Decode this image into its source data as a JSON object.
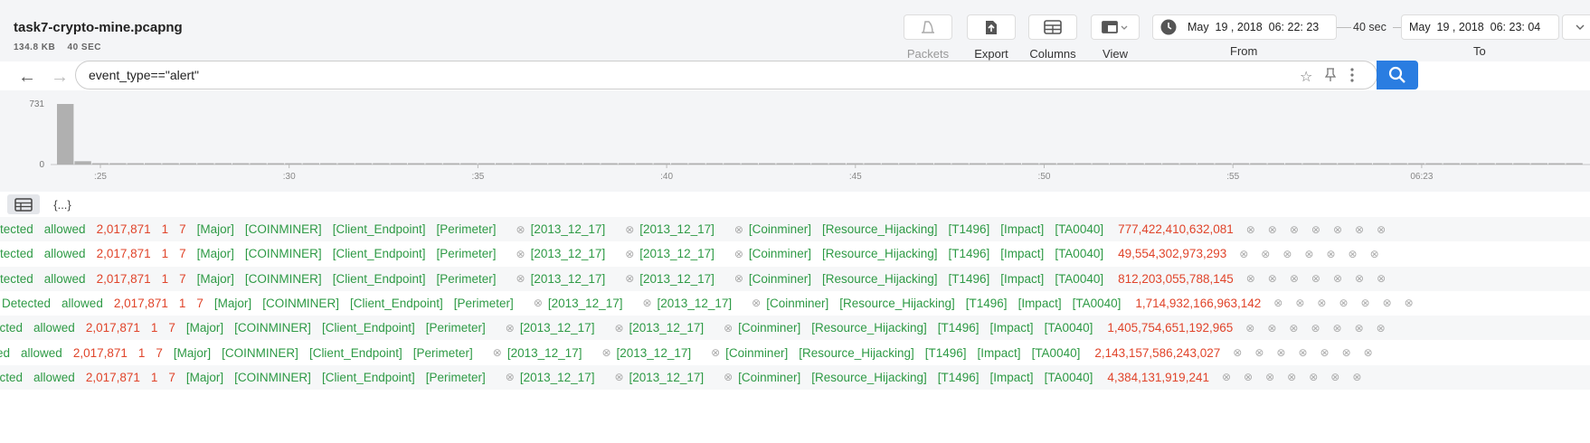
{
  "file": {
    "name": "task7-crypto-mine.pcapng",
    "size": "134.8 KB",
    "duration": "40 SEC"
  },
  "toolbar": {
    "packets": "Packets",
    "export": "Export",
    "columns": "Columns",
    "view": "View",
    "from_value": "May  19 , 2018  06: 22: 23",
    "from_label": "From",
    "span": "40 sec",
    "to_value": "May  19 , 2018  06: 23: 04",
    "to_label": "To"
  },
  "search": {
    "query": "event_type==\"alert\""
  },
  "histogram": {
    "y_max_label": "731",
    "y_min_label": "0",
    "ticks": [
      ":25",
      ":30",
      ":35",
      ":40",
      ":45",
      ":50",
      ":55",
      "06:23"
    ],
    "bar_color": "#b0b0b0",
    "bars": [
      731,
      40,
      3,
      2,
      2,
      1,
      1,
      2,
      1,
      2,
      2,
      1,
      2,
      3,
      1,
      1,
      2,
      1,
      2,
      1,
      2,
      1,
      1,
      2,
      1,
      2,
      1,
      3,
      1,
      1,
      2,
      3,
      8,
      1,
      3,
      2,
      2,
      1,
      2,
      1,
      2,
      2,
      2,
      4,
      1,
      1,
      2,
      1,
      1,
      2,
      4,
      1,
      2,
      1,
      1,
      2,
      1,
      2,
      1,
      2,
      1,
      2,
      1,
      2,
      1,
      2,
      1,
      5,
      2,
      1,
      2,
      1,
      2,
      1,
      2,
      1,
      1,
      8,
      1,
      1,
      2,
      1,
      2,
      1,
      2,
      1,
      12
    ]
  },
  "tabs": {
    "table_icon": "table-icon",
    "json_label": "{...}"
  },
  "colors": {
    "green": "#2e9a45",
    "red": "#e0442a",
    "accent": "#2a7de1"
  },
  "rows": [
    {
      "status": "tected",
      "action": "allowed",
      "sig": "2,017,871",
      "rev": "1",
      "gid": "7",
      "severity": "[Major]",
      "family": "[COINMINER]",
      "target": "[Client_Endpoint]",
      "scope": "[Perimeter]",
      "created": "[2013_12_17]",
      "updated": "[2013_12_17]",
      "tag": "[Coinminer]",
      "category": "[Resource_Hijacking]",
      "technique": "[T1496]",
      "tactic": "[Impact]",
      "tactic_id": "[TA0040]",
      "flow": "777,422,410,632,081"
    },
    {
      "status": "tected",
      "action": "allowed",
      "sig": "2,017,871",
      "rev": "1",
      "gid": "7",
      "severity": "[Major]",
      "family": "[COINMINER]",
      "target": "[Client_Endpoint]",
      "scope": "[Perimeter]",
      "created": "[2013_12_17]",
      "updated": "[2013_12_17]",
      "tag": "[Coinminer]",
      "category": "[Resource_Hijacking]",
      "technique": "[T1496]",
      "tactic": "[Impact]",
      "tactic_id": "[TA0040]",
      "flow": "49,554,302,973,293"
    },
    {
      "status": "tected",
      "action": "allowed",
      "sig": "2,017,871",
      "rev": "1",
      "gid": "7",
      "severity": "[Major]",
      "family": "[COINMINER]",
      "target": "[Client_Endpoint]",
      "scope": "[Perimeter]",
      "created": "[2013_12_17]",
      "updated": "[2013_12_17]",
      "tag": "[Coinminer]",
      "category": "[Resource_Hijacking]",
      "technique": "[T1496]",
      "tactic": "[Impact]",
      "tactic_id": "[TA0040]",
      "flow": "812,203,055,788,145"
    },
    {
      "status": "Detected",
      "action": "allowed",
      "sig": "2,017,871",
      "rev": "1",
      "gid": "7",
      "severity": "[Major]",
      "family": "[COINMINER]",
      "target": "[Client_Endpoint]",
      "scope": "[Perimeter]",
      "created": "[2013_12_17]",
      "updated": "[2013_12_17]",
      "tag": "[Coinminer]",
      "category": "[Resource_Hijacking]",
      "technique": "[T1496]",
      "tactic": "[Impact]",
      "tactic_id": "[TA0040]",
      "flow": "1,714,932,166,963,142"
    },
    {
      "status": "ected",
      "action": "allowed",
      "sig": "2,017,871",
      "rev": "1",
      "gid": "7",
      "severity": "[Major]",
      "family": "[COINMINER]",
      "target": "[Client_Endpoint]",
      "scope": "[Perimeter]",
      "created": "[2013_12_17]",
      "updated": "[2013_12_17]",
      "tag": "[Coinminer]",
      "category": "[Resource_Hijacking]",
      "technique": "[T1496]",
      "tactic": "[Impact]",
      "tactic_id": "[TA0040]",
      "flow": "1,405,754,651,192,965"
    },
    {
      "status": "ed",
      "action": "allowed",
      "sig": "2,017,871",
      "rev": "1",
      "gid": "7",
      "severity": "[Major]",
      "family": "[COINMINER]",
      "target": "[Client_Endpoint]",
      "scope": "[Perimeter]",
      "created": "[2013_12_17]",
      "updated": "[2013_12_17]",
      "tag": "[Coinminer]",
      "category": "[Resource_Hijacking]",
      "technique": "[T1496]",
      "tactic": "[Impact]",
      "tactic_id": "[TA0040]",
      "flow": "2,143,157,586,243,027"
    },
    {
      "status": "ected",
      "action": "allowed",
      "sig": "2,017,871",
      "rev": "1",
      "gid": "7",
      "severity": "[Major]",
      "family": "[COINMINER]",
      "target": "[Client_Endpoint]",
      "scope": "[Perimeter]",
      "created": "[2013_12_17]",
      "updated": "[2013_12_17]",
      "tag": "[Coinminer]",
      "category": "[Resource_Hijacking]",
      "technique": "[T1496]",
      "tactic": "[Impact]",
      "tactic_id": "[TA0040]",
      "flow": "4,384,131,919,241"
    }
  ]
}
